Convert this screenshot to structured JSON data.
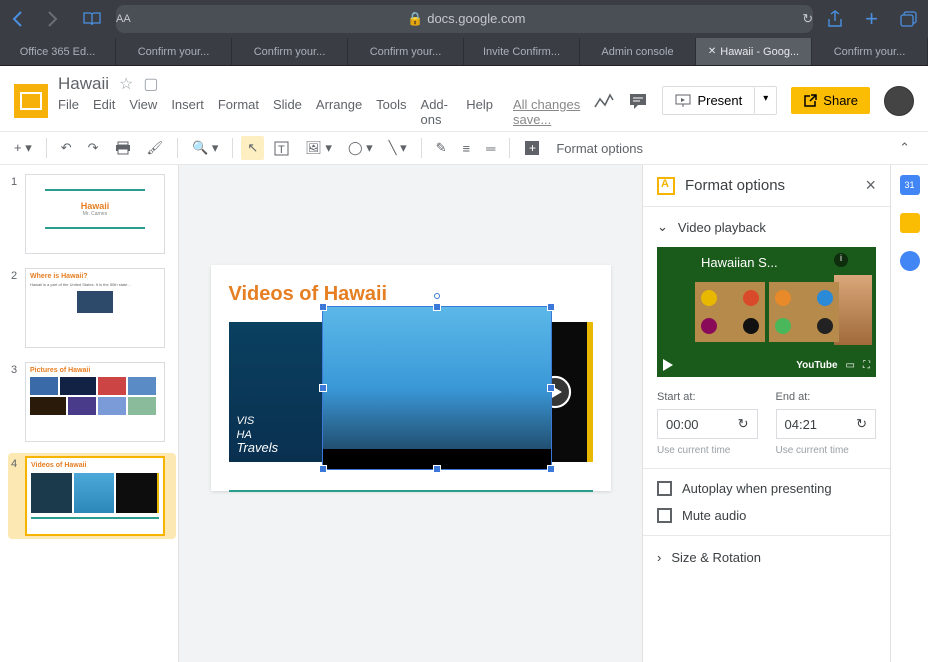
{
  "browser": {
    "url": "docs.google.com",
    "tabs": [
      "Office 365 Ed...",
      "Confirm your...",
      "Confirm your...",
      "Confirm your...",
      "Invite Confirm...",
      "Admin console",
      "Hawaii - Goog...",
      "Confirm your..."
    ],
    "active_tab": 6
  },
  "doc": {
    "title": "Hawaii",
    "saved": "All changes save...",
    "menu": [
      "File",
      "Edit",
      "View",
      "Insert",
      "Format",
      "Slide",
      "Arrange",
      "Tools",
      "Add-ons",
      "Help"
    ],
    "present": "Present",
    "share": "Share"
  },
  "toolbar": {
    "format_options": "Format options"
  },
  "slides": {
    "s1": {
      "title": "Hawaii",
      "sub": "Mr. Carnes"
    },
    "s2": {
      "title": "Where is Hawaii?",
      "text": "Hawaii is a part of the United States. It is the 50th state..."
    },
    "s3": {
      "title": "Pictures of Hawaii"
    },
    "s4": {
      "title": "Videos of Hawaii"
    }
  },
  "canvas": {
    "title": "Videos of Hawaii",
    "v1a": "VIS",
    "v1b": "HA",
    "travels": "Travels"
  },
  "panel": {
    "title": "Format options",
    "video_playback": "Video playback",
    "preview_title": "Hawaiian S...",
    "youtube": "YouTube",
    "start_label": "Start at:",
    "end_label": "End at:",
    "start": "00:00",
    "end": "04:21",
    "use_current": "Use current time",
    "autoplay": "Autoplay when presenting",
    "mute": "Mute audio",
    "size_rotation": "Size & Rotation"
  }
}
